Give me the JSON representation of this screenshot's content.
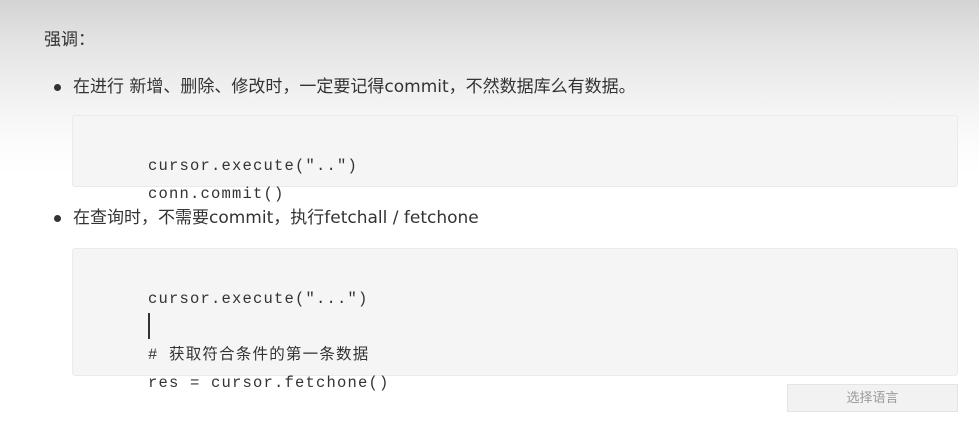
{
  "heading": "强调：",
  "items": [
    {
      "text": "在进行 新增、删除、修改时，一定要记得commit，不然数据库么有数据。",
      "code": [
        "cursor.execute(\"..\")",
        "conn.commit()"
      ]
    },
    {
      "text": "在查询时，不需要commit，执行fetchall / fetchone",
      "code": [
        "cursor.execute(\"...\")",
        "",
        "# 获取符合条件的第一条数据",
        "res = cursor.fetchone()"
      ]
    }
  ],
  "language_selector": {
    "placeholder": "选择语言"
  }
}
